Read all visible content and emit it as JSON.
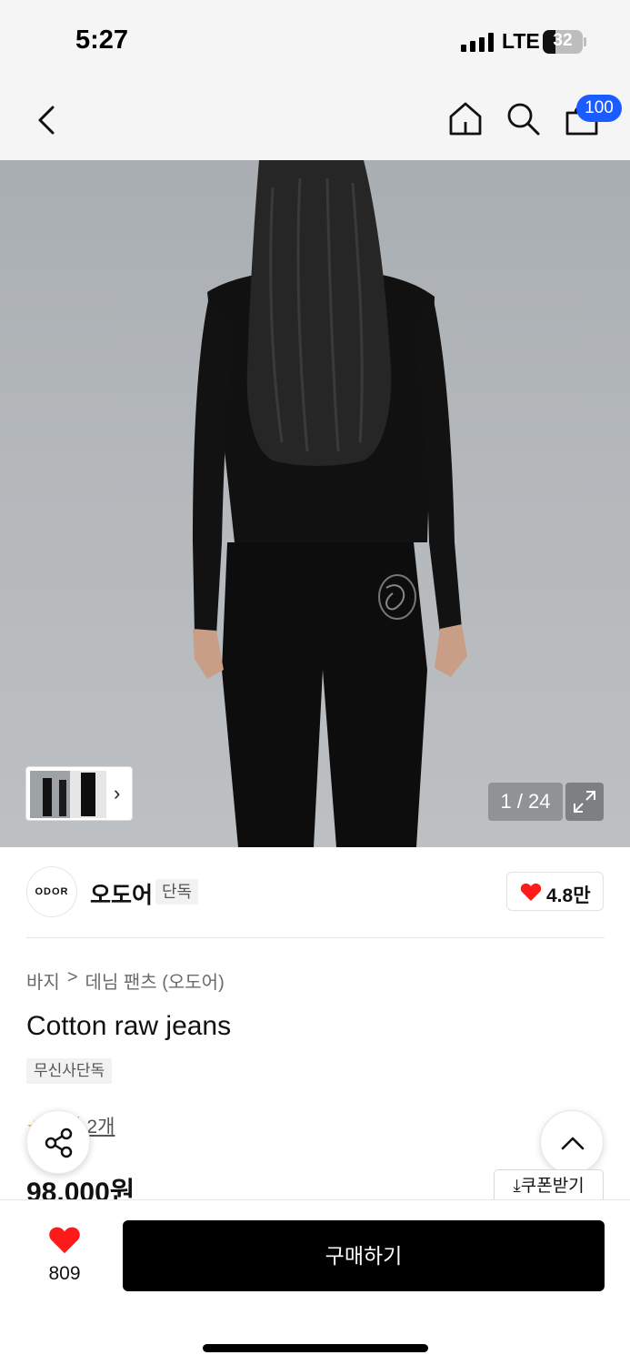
{
  "status_bar": {
    "time": "5:27",
    "network": "LTE",
    "battery": "32",
    "battery_level": 0.32
  },
  "nav": {
    "cart_count": "100"
  },
  "gallery": {
    "counter": "1 / 24"
  },
  "brand": {
    "logo_text": "ODOR",
    "name": "오도어",
    "tag": "단독",
    "likes": "4.8만"
  },
  "breadcrumb": {
    "category": "바지",
    "separator": ">",
    "subcategory": "데님 팬츠 (오도어)"
  },
  "product": {
    "title": "Cotton raw jeans",
    "badge": "무신사단독",
    "review_label": "후기 2개",
    "price": "98,000원"
  },
  "coupon": {
    "label": "쿠폰받기"
  },
  "bottom": {
    "wish_count": "809",
    "buy_label": "구매하기"
  },
  "colors": {
    "accent": "#1a5cff",
    "heart": "#ff1a1a",
    "buy": "#000000"
  }
}
